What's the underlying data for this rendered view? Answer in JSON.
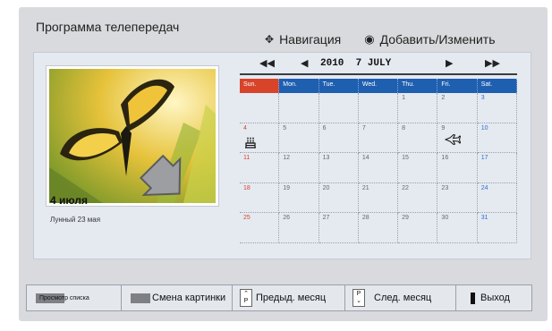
{
  "header": {
    "title": "Программа телепередач",
    "nav_label": "Навигация",
    "add_label": "Добавить/Изменить"
  },
  "selected_date": {
    "date": "4 июля",
    "lunar": "Лунный 23 мая"
  },
  "calendar": {
    "year": "2010",
    "month_label": "7 JULY",
    "weekdays": [
      "Sun.",
      "Mon.",
      "Tue.",
      "Wed.",
      "Thu.",
      "Fri.",
      "Sat."
    ],
    "weeks": [
      [
        "",
        "",
        "",
        "",
        "1",
        "2",
        "3"
      ],
      [
        "4",
        "5",
        "6",
        "7",
        "8",
        "9",
        "10"
      ],
      [
        "11",
        "12",
        "13",
        "14",
        "15",
        "16",
        "17"
      ],
      [
        "18",
        "19",
        "20",
        "21",
        "22",
        "23",
        "24"
      ],
      [
        "25",
        "26",
        "27",
        "28",
        "29",
        "30",
        "31"
      ]
    ],
    "event_icons": [
      {
        "day": "4",
        "icon": "birthday-cake-icon"
      },
      {
        "day": "9",
        "icon": "airplane-icon"
      }
    ]
  },
  "buttons": {
    "list_view": "Просмотр списка",
    "change_picture": "Смена картинки",
    "prev_month": "Предыд. месяц",
    "next_month": "След. месяц",
    "exit": "Выход",
    "p_key": "P"
  },
  "colors": {
    "sunday_header": "#d7442a",
    "weekday_header": "#1e5fb0",
    "chip": "#7f8085",
    "background": "#d9dadd"
  }
}
